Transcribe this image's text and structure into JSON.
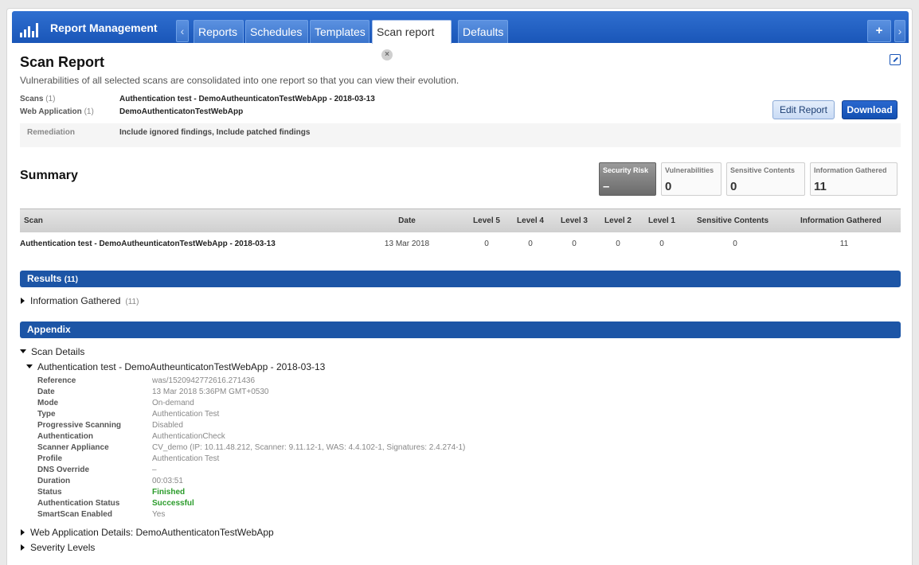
{
  "app": {
    "title": "Report Management"
  },
  "tabs": [
    {
      "label": "Reports"
    },
    {
      "label": "Schedules"
    },
    {
      "label": "Templates"
    },
    {
      "label": "Scan report",
      "active": true
    },
    {
      "label": "Defaults"
    }
  ],
  "nav": {
    "prev": "‹",
    "next": "›",
    "add": "+",
    "close": "×"
  },
  "page": {
    "title": "Scan Report",
    "description": "Vulnerabilities of all selected scans are consolidated into one report so that you can view their evolution."
  },
  "meta": {
    "scans_label": "Scans",
    "scans_count": "(1)",
    "scans_value": "Authentication test - DemoAutheunticatonTestWebApp - 2018-03-13",
    "webapp_label": "Web Application",
    "webapp_count": "(1)",
    "webapp_value": "DemoAuthenticatonTestWebApp",
    "remediation_label": "Remediation",
    "remediation_value": "Include ignored findings, Include patched findings"
  },
  "actions": {
    "edit": "Edit Report",
    "download": "Download"
  },
  "summary": {
    "title": "Summary",
    "stats": [
      {
        "label": "Security Risk",
        "value": "–"
      },
      {
        "label": "Vulnerabilities",
        "value": "0"
      },
      {
        "label": "Sensitive Contents",
        "value": "0"
      },
      {
        "label": "Information Gathered",
        "value": "11"
      }
    ],
    "columns": [
      "Scan",
      "Date",
      "Level 5",
      "Level 4",
      "Level 3",
      "Level 2",
      "Level 1",
      "Sensitive Contents",
      "Information Gathered"
    ],
    "rows": [
      {
        "scan": "Authentication test - DemoAutheunticatonTestWebApp - 2018-03-13",
        "date": "13 Mar 2018",
        "l5": "0",
        "l4": "0",
        "l3": "0",
        "l2": "0",
        "l1": "0",
        "sensitive": "0",
        "info": "11"
      }
    ]
  },
  "results": {
    "title": "Results",
    "count": "(11)",
    "items": [
      {
        "label": "Information Gathered",
        "count": "(11)"
      }
    ]
  },
  "appendix": {
    "title": "Appendix",
    "scan_details": "Scan Details",
    "scan_name": "Authentication test - DemoAutheunticatonTestWebApp - 2018-03-13",
    "details": [
      {
        "label": "Reference",
        "value": "was/1520942772616.271436"
      },
      {
        "label": "Date",
        "value": "13 Mar 2018 5:36PM GMT+0530"
      },
      {
        "label": "Mode",
        "value": "On-demand"
      },
      {
        "label": "Type",
        "value": "Authentication Test"
      },
      {
        "label": "Progressive Scanning",
        "value": "Disabled"
      },
      {
        "label": "Authentication",
        "value": "AuthenticationCheck"
      },
      {
        "label": "Scanner Appliance",
        "value": "CV_demo (IP: 10.11.48.212, Scanner: 9.11.12-1, WAS: 4.4.102-1, Signatures: 2.4.274-1)"
      },
      {
        "label": "Profile",
        "value": "Authentication Test"
      },
      {
        "label": "DNS Override",
        "value": "–"
      },
      {
        "label": "Duration",
        "value": "00:03:51"
      },
      {
        "label": "Status",
        "value": "Finished"
      },
      {
        "label": "Authentication Status",
        "value": "Successful"
      },
      {
        "label": "SmartScan Enabled",
        "value": "Yes"
      }
    ],
    "webapp_details": "Web Application Details: DemoAuthenticatonTestWebApp",
    "severity_levels": "Severity Levels"
  },
  "colors": {
    "brand": "#1a56b8",
    "section": "#1c55a6",
    "success": "#2a9b2a"
  }
}
